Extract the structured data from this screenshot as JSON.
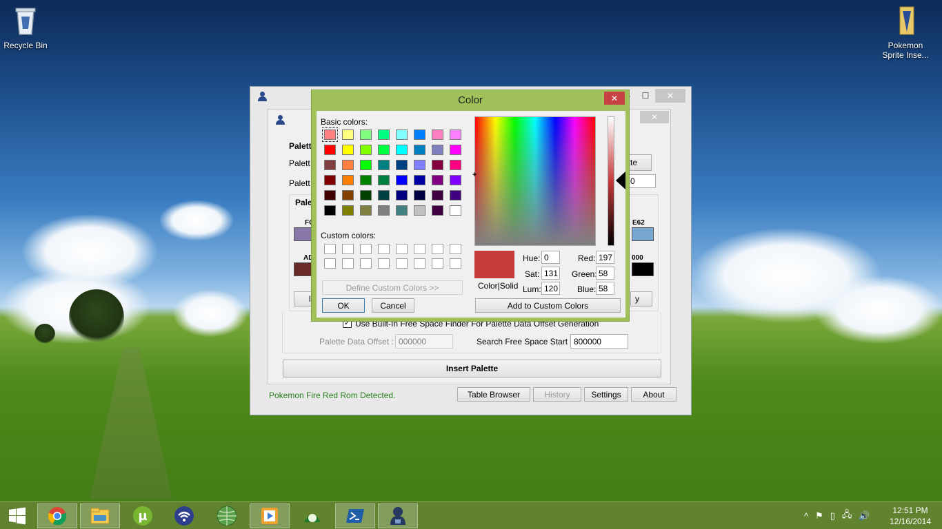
{
  "desktop": {
    "icons": [
      {
        "label": "Recycle Bin"
      },
      {
        "label_line1": "Pokemon",
        "label_line2": "Sprite Inse..."
      }
    ]
  },
  "main_window": {
    "title_buttons": {
      "minimize": "—",
      "maximize": "☐",
      "close": "✕"
    },
    "inner_close": "✕",
    "labels": {
      "palette_header": "Palett",
      "palette_row1": "Palett",
      "palette_row2": "Palett",
      "palette_group": "Palet",
      "fc": "FC",
      "ad": "AD",
      "e62": "E62",
      "s000": "000",
      "ette_button": "ette",
      "row2_value": "0",
      "left_btn": "I",
      "right_btn": "y"
    },
    "checkbox_label": "Use Built-In Free Space Finder For Palette Data Offset Generation",
    "checkbox_mark": "✓",
    "palette_data_offset_label": "Palette Data Offset :",
    "palette_data_offset_value": "000000",
    "search_free_space_label": "Search Free Space Start :",
    "search_free_space_value": "800000",
    "insert_palette": "Insert Palette",
    "status": "Pokemon Fire Red Rom Detected.",
    "bottom_buttons": [
      "Table Browser",
      "History",
      "Settings",
      "About"
    ],
    "colors": {
      "status_text": "#2a7d1e",
      "swatch_fc": "#8878a8",
      "swatch_ad": "#6a2a2a",
      "swatch_e62": "#78a8d0",
      "swatch_000": "#000000"
    }
  },
  "color_dialog": {
    "title": "Color",
    "close": "✕",
    "basic_colors_label": "Basic colors:",
    "custom_colors_label": "Custom colors:",
    "define_custom": "Define Custom Colors >>",
    "ok": "OK",
    "cancel": "Cancel",
    "add_custom": "Add to Custom Colors",
    "color_solid_label": "Color|Solid",
    "hue_label": "Hue:",
    "sat_label": "Sat:",
    "lum_label": "Lum:",
    "red_label": "Red:",
    "green_label": "Green:",
    "blue_label": "Blue:",
    "hue": "0",
    "sat": "131",
    "lum": "120",
    "red": "197",
    "green": "58",
    "blue": "58",
    "preview_color": "#c53a3a",
    "basic_colors": [
      [
        "#ff8080",
        "#ffff80",
        "#80ff80",
        "#00ff80",
        "#80ffff",
        "#0080ff",
        "#ff80c0",
        "#ff80ff"
      ],
      [
        "#ff0000",
        "#ffff00",
        "#80ff00",
        "#00ff40",
        "#00ffff",
        "#0080c0",
        "#8080c0",
        "#ff00ff"
      ],
      [
        "#804040",
        "#ff8040",
        "#00ff00",
        "#008080",
        "#004080",
        "#8080ff",
        "#800040",
        "#ff0080"
      ],
      [
        "#800000",
        "#ff8000",
        "#008000",
        "#008040",
        "#0000ff",
        "#0000a0",
        "#800080",
        "#8000ff"
      ],
      [
        "#400000",
        "#804000",
        "#004000",
        "#004040",
        "#000080",
        "#000040",
        "#400040",
        "#400080"
      ],
      [
        "#000000",
        "#808000",
        "#808040",
        "#808080",
        "#408080",
        "#c0c0c0",
        "#400040",
        "#ffffff"
      ]
    ]
  },
  "taskbar": {
    "apps": [
      "start",
      "chrome",
      "file-explorer",
      "utorrent",
      "wifi-app",
      "globe-app",
      "media-player",
      "game-app",
      "powershell",
      "app-user"
    ],
    "tray_icons": [
      "^",
      "⚑",
      "▯",
      "🖧",
      "🔊"
    ],
    "time": "12:51 PM",
    "date": "12/16/2014"
  }
}
